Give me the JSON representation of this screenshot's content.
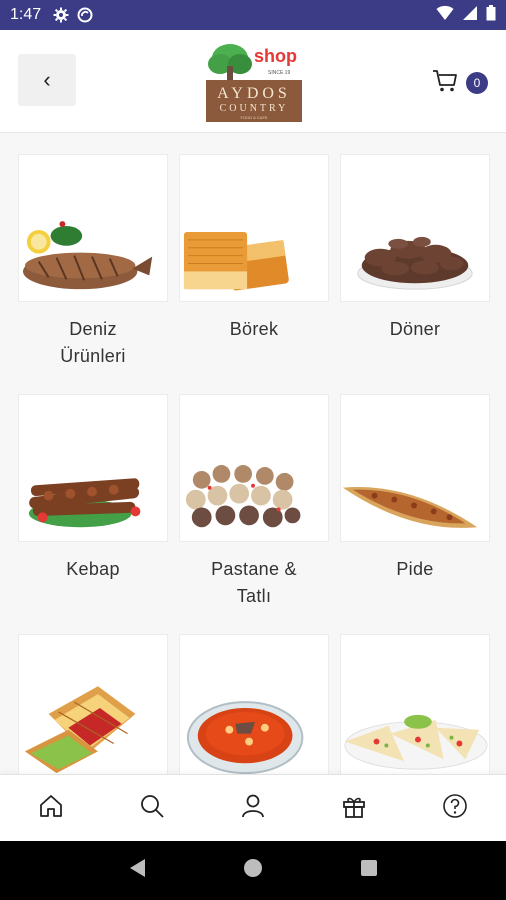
{
  "status_bar": {
    "time": "1:47"
  },
  "header": {
    "back_label": "‹",
    "logo": {
      "shop": "shop",
      "brand_top": "AYDOS",
      "brand_bottom": "COUNTRY",
      "tagline": "SINCE 19",
      "sub": "FOOD & CAFE"
    },
    "cart_count": "0"
  },
  "categories": [
    {
      "label_line1": "Deniz",
      "label_line2": "Ürünleri",
      "image": "grilled-fish"
    },
    {
      "label_line1": "Börek",
      "label_line2": "",
      "image": "borek-pastry"
    },
    {
      "label_line1": "Döner",
      "label_line2": "",
      "image": "doner-meat"
    },
    {
      "label_line1": "Kebap",
      "label_line2": "",
      "image": "kebab-skewers"
    },
    {
      "label_line1": "Pastane &",
      "label_line2": "Tatlı",
      "image": "pastries"
    },
    {
      "label_line1": "Pide",
      "label_line2": "",
      "image": "pide"
    },
    {
      "label_line1": "",
      "label_line2": "",
      "image": "toast-sandwich"
    },
    {
      "label_line1": "",
      "label_line2": "",
      "image": "soup"
    },
    {
      "label_line1": "",
      "label_line2": "",
      "image": "quesadilla"
    }
  ],
  "bottom_nav": [
    "home-icon",
    "search-icon",
    "user-icon",
    "gift-icon",
    "help-icon"
  ],
  "colors": {
    "primary": "#3b3b86",
    "logo_red": "#e53935",
    "logo_brown": "#8b5a3c"
  }
}
